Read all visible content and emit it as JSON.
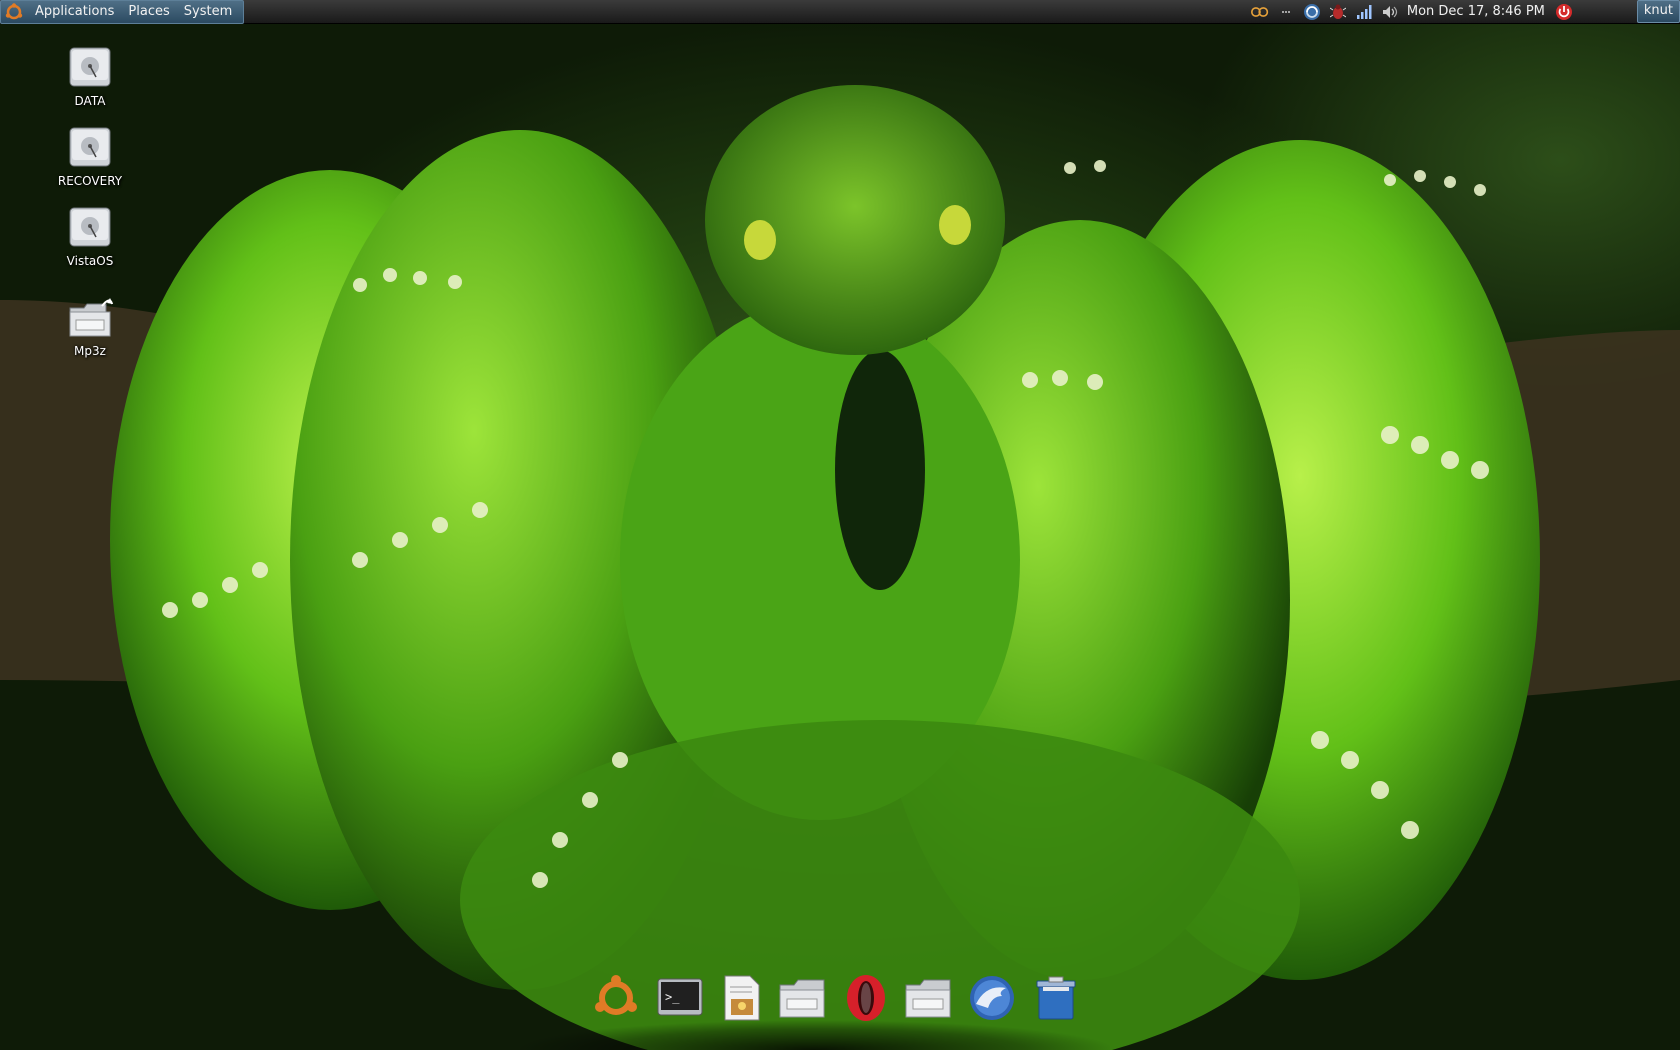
{
  "top_panel": {
    "menus": [
      "Applications",
      "Places",
      "System"
    ],
    "tray_icons": [
      "gnome-do-icon",
      "network-sync-icon",
      "bug-icon",
      "signal-strength-icon",
      "volume-icon"
    ],
    "clock": "Mon Dec 17,  8:46 PM",
    "power_icon": "power-icon",
    "user": "knut"
  },
  "desktop_icons": [
    {
      "label": "DATA",
      "icon": "drive-icon"
    },
    {
      "label": "RECOVERY",
      "icon": "drive-icon"
    },
    {
      "label": "VistaOS",
      "icon": "drive-icon"
    },
    {
      "label": "Mp3z",
      "icon": "folder-link-icon"
    }
  ],
  "dock": {
    "items": [
      "ubuntu-logo-icon",
      "terminal-icon",
      "text-editor-icon",
      "folder-icon",
      "opera-icon",
      "folder-icon",
      "thunderbird-icon",
      "trash-icon"
    ]
  },
  "colors": {
    "panel": "#1a1a1a",
    "menu_accent": "#2b4a61",
    "snake_green": "#6bd01c"
  }
}
